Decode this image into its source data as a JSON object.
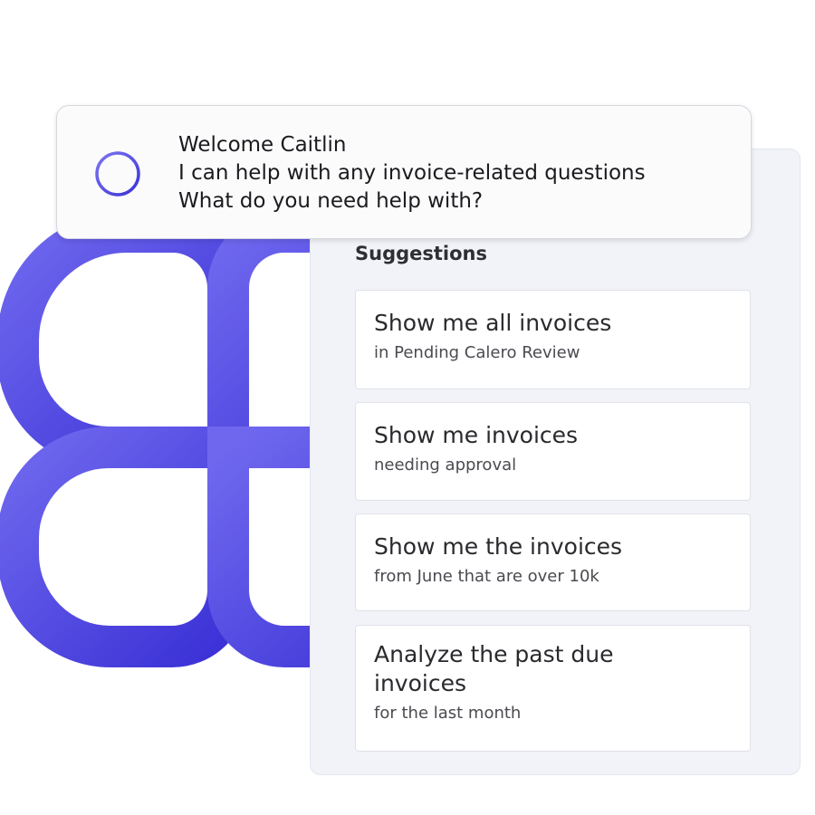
{
  "brand": {
    "accent": "#4a3fdb",
    "accent_light": "#6f68ee",
    "panel_bg": "#f1f3f8",
    "card_bg": "#ffffff"
  },
  "greeting": {
    "line1": "Welcome Caitlin",
    "line2": "I can help with any invoice-related questions",
    "line3": "What do you need help with?",
    "icon": "assistant-ring-icon"
  },
  "suggestions": {
    "heading": "Suggestions",
    "items": [
      {
        "title": "Show me all invoices",
        "subtitle": "in Pending Calero Review"
      },
      {
        "title": "Show me invoices",
        "subtitle": "needing approval"
      },
      {
        "title": "Show me the invoices",
        "subtitle": "from June that are over 10k"
      },
      {
        "title": "Analyze the past due invoices",
        "subtitle": "for the last month"
      }
    ]
  }
}
